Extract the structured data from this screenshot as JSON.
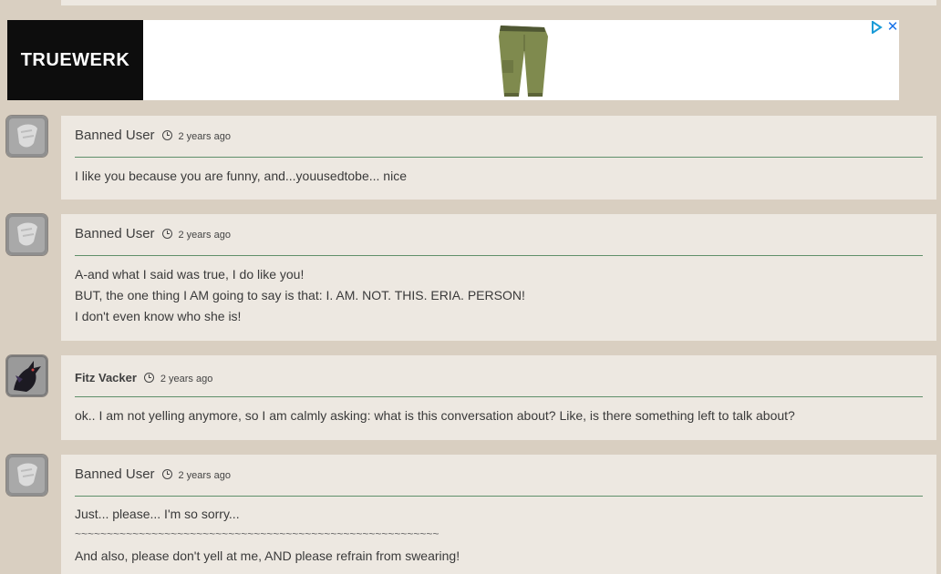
{
  "ad": {
    "brand": "TRUEWERK",
    "product_image": "olive-work-pants",
    "adchoices_icon": "adchoices-triangle-icon",
    "close_label": "✕"
  },
  "colors": {
    "page_background": "#d9cfc1",
    "card_background": "#ede8e1",
    "divider": "#5f8f6a",
    "ad_close": "#1a73e8"
  },
  "comments": [
    {
      "author": "Banned User",
      "time": "2 years ago",
      "avatar_icon": "banned-user-avatar-icon",
      "lines": [
        "I like you because you are funny, and...youusedtobe... nice"
      ]
    },
    {
      "author": "Banned User",
      "time": "2 years ago",
      "avatar_icon": "banned-user-avatar-icon",
      "lines": [
        "A-and what I said was true, I do like you!",
        "BUT, the one thing I AM going to say is that: I. AM. NOT. THIS. ERIA. PERSON!",
        "I don't even know who she is!"
      ]
    },
    {
      "author": "Fitz Vacker",
      "time": "2 years ago",
      "avatar_icon": "dragon-avatar-icon",
      "lines": [
        "ok.. I am not yelling anymore, so I am calmly asking: what is this conversation about? Like, is there something left to talk about?"
      ]
    },
    {
      "author": "Banned User",
      "time": "2 years ago",
      "avatar_icon": "banned-user-avatar-icon",
      "lines": [
        "Just... please... I'm so sorry...",
        "~~~~~~~~~~~~~~~~~~~~~~~~~~~~~~~~~~~~~~~~~~~~~~~~~~~~~~~~~",
        "And also, please don't yell at me, AND please refrain from swearing!"
      ]
    }
  ]
}
